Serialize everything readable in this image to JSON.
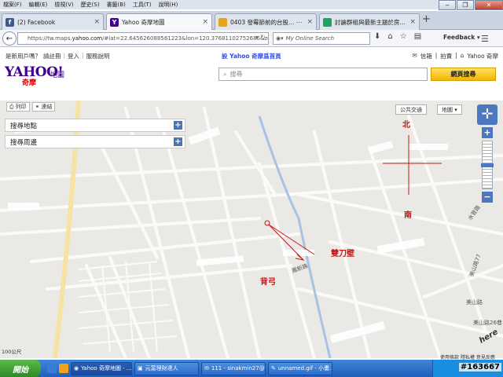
{
  "menu": [
    "檔案(F)",
    "編輯(E)",
    "檢視(V)",
    "歷史(S)",
    "書籤(B)",
    "工具(T)",
    "說明(H)"
  ],
  "tabs": [
    {
      "title": "(2) Facebook",
      "icon_color": "#3b5998",
      "icon_glyph": "f"
    },
    {
      "title": "Yahoo 奇摩地圖",
      "icon_color": "#400090",
      "icon_glyph": "Y"
    },
    {
      "title": "0403 發霉節前的台股…  ⋯",
      "icon_color": "#e8a317",
      "icon_glyph": ""
    },
    {
      "title": "討論群組與最新主題於房…",
      "icon_color": "#1da462",
      "icon_glyph": ""
    }
  ],
  "nav": {
    "url_prefix": "https://tw.maps.",
    "url_domain": "yahoo.com",
    "url_rest": "/#lat=22.645626088561223&lon=120.37681102752686&zoom=",
    "search_placeholder": "My Online Search",
    "feedback_label": "Feedback"
  },
  "yahoo": {
    "new_user": "是新用戶嗎？",
    "register": "請註冊",
    "login": "登入",
    "help": "服務說明",
    "set_home": "設 Yahoo 奇摩爲首頁",
    "mail": "信箱",
    "shopping": "拍賣",
    "yahoo_home": "Yahoo 奇摩",
    "logo_text": "YAHOO!",
    "logo_sub": "奇摩",
    "logo_product": "地圖",
    "search_placeholder": "搜尋",
    "search_button": "網頁搜尋"
  },
  "map": {
    "print_label": "列印",
    "link_label": "連結",
    "panels": [
      "搜尋地點",
      "搜尋周邊"
    ],
    "transit_button": "公共交通",
    "map_type_button": "地圖",
    "zoom_level": 0.5,
    "annotations": {
      "north": "北",
      "south": "南",
      "double_blade": "雙刀壁",
      "back_bow": "背弓"
    },
    "road_labels": [
      "水管路",
      "美山路77",
      "美山路",
      "美山路26巷",
      "鳳新路"
    ],
    "scale_text": "100公尺",
    "legal": [
      "使用條款",
      "隱私權",
      "意見反應"
    ],
    "provider": "here"
  },
  "taskbar": {
    "start": "開始",
    "buttons": [
      "Yahoo 奇摩地圖 - ...",
      "元富理財達人",
      "111 - sinakmin27@...",
      "unnamed.gif - 小畫..."
    ],
    "stamp": "#163667"
  }
}
